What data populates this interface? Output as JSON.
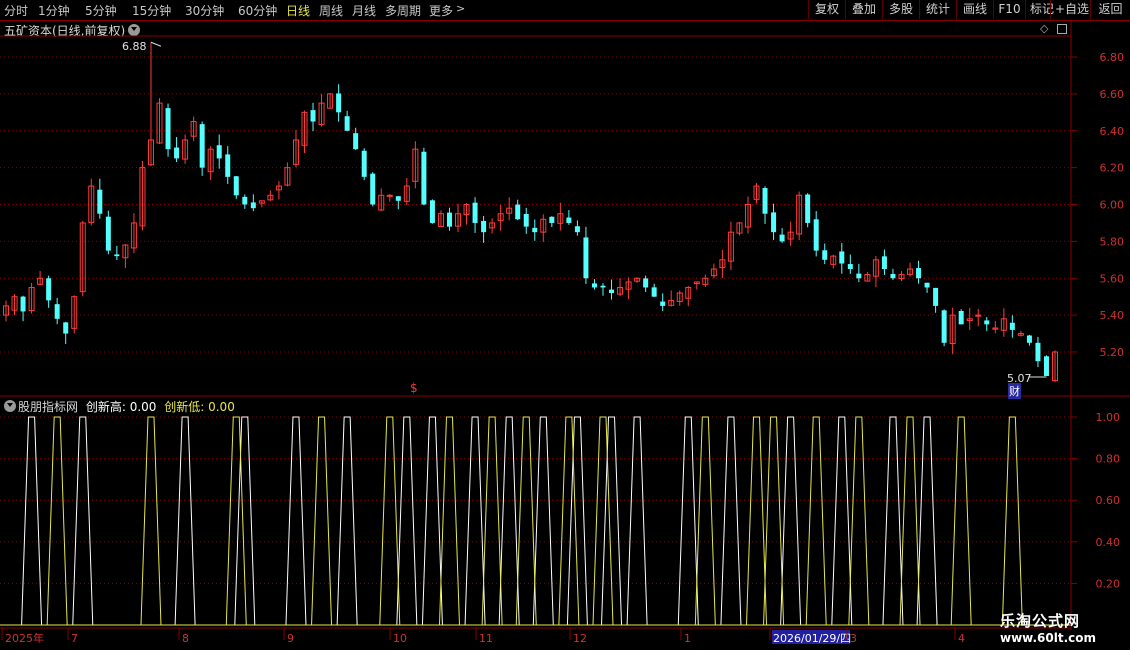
{
  "toolbar": {
    "periods": [
      "分时",
      "1分钟",
      "5分钟",
      "15分钟",
      "30分钟",
      "60分钟",
      "日线",
      "周线",
      "月线",
      "多周期",
      "更多"
    ],
    "active_period": "日线",
    "right_buttons": [
      "复权",
      "叠加",
      "多股",
      "统计",
      "画线",
      "F10",
      "标记",
      "+自选",
      "返回"
    ]
  },
  "main_chart": {
    "title": "五矿资本(日线,前复权)",
    "high_label": "6.88",
    "low_label": "5.07",
    "cai_label": "财",
    "dollar_marker": "$",
    "y_ticks": [
      "6.80",
      "6.60",
      "6.40",
      "6.20",
      "6.00",
      "5.80",
      "5.60",
      "5.40",
      "5.20"
    ]
  },
  "indicator": {
    "name": "股朋指标网",
    "new_high_label": "创新高: 0.00",
    "new_low_label": "创新低: 0.00",
    "y_ticks": [
      "1.00",
      "0.80",
      "0.60",
      "0.40",
      "0.20"
    ]
  },
  "date_axis": {
    "labels": [
      "2025年",
      "7",
      "8",
      "9",
      "10",
      "11",
      "12",
      "1",
      "2026/01/29/四",
      "3",
      "4"
    ]
  },
  "watermark": {
    "line1": "乐淘公式网",
    "line2": "www.60lt.com"
  },
  "colors": {
    "up": "#ff3b3b",
    "down": "#54ffff",
    "grid": "#8a0000",
    "high_line": "#ffffff",
    "low_line": "#e8e84a",
    "axis_text": "#d03030"
  },
  "chart_data": {
    "type": "candlestick",
    "price_range": [
      5.07,
      6.88
    ],
    "closes": [
      5.45,
      5.5,
      5.42,
      5.55,
      5.6,
      5.48,
      5.38,
      5.3,
      5.5,
      5.9,
      6.1,
      5.95,
      5.75,
      5.72,
      5.78,
      5.9,
      6.2,
      6.35,
      6.55,
      6.3,
      6.25,
      6.35,
      6.45,
      6.2,
      6.3,
      6.25,
      6.15,
      6.05,
      6.0,
      5.98,
      6.02,
      6.05,
      6.1,
      6.2,
      6.35,
      6.5,
      6.45,
      6.55,
      6.6,
      6.5,
      6.4,
      6.3,
      6.15,
      6.0,
      6.05,
      6.05,
      6.02,
      6.1,
      6.3,
      6.0,
      5.9,
      5.95,
      5.88,
      5.95,
      6.0,
      5.9,
      5.85,
      5.9,
      5.95,
      5.98,
      5.92,
      5.88,
      5.85,
      5.92,
      5.9,
      5.95,
      5.9,
      5.85,
      5.6,
      5.55,
      5.55,
      5.52,
      5.55,
      5.58,
      5.6,
      5.55,
      5.5,
      5.45,
      5.48,
      5.52,
      5.55,
      5.58,
      5.6,
      5.65,
      5.7,
      5.85,
      5.9,
      6.0,
      6.1,
      5.95,
      5.85,
      5.8,
      5.85,
      6.05,
      5.9,
      5.75,
      5.7,
      5.72,
      5.68,
      5.65,
      5.6,
      5.62,
      5.7,
      5.65,
      5.6,
      5.62,
      5.65,
      5.6,
      5.55,
      5.45,
      5.25,
      5.4,
      5.35,
      5.38,
      5.4,
      5.35,
      5.33,
      5.38,
      5.32,
      5.3,
      5.25,
      5.15,
      5.07,
      5.2
    ],
    "new_high_pulses": [
      3,
      9,
      21,
      28,
      34,
      40,
      47,
      50,
      55,
      59,
      63,
      67,
      71,
      74,
      80,
      85,
      92,
      98,
      104,
      108
    ],
    "new_low_pulses": [
      6,
      17,
      27,
      37,
      45,
      52,
      57,
      61,
      66,
      70,
      82,
      88,
      90,
      95,
      100,
      106,
      112,
      118
    ]
  }
}
